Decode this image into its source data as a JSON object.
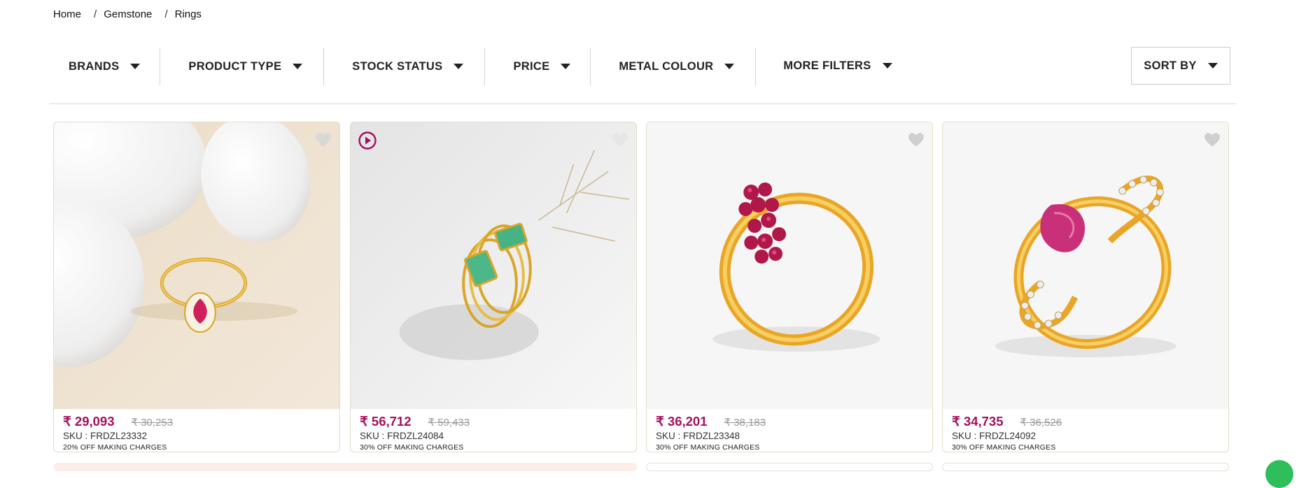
{
  "breadcrumb": {
    "home": "Home",
    "sep": "/",
    "category": "Gemstone",
    "current": "Rings"
  },
  "filters": [
    {
      "label": "BRANDS",
      "icon": "chevron-down-icon"
    },
    {
      "label": "PRODUCT TYPE",
      "icon": "chevron-down-icon"
    },
    {
      "label": "STOCK STATUS",
      "icon": "chevron-down-icon"
    },
    {
      "label": "PRICE",
      "icon": "chevron-down-icon"
    },
    {
      "label": "METAL COLOUR",
      "icon": "chevron-down-icon"
    },
    {
      "label": "MORE FILTERS",
      "icon": "chevron-down-icon"
    }
  ],
  "sort": {
    "label": "SORT BY",
    "icon": "chevron-down-icon"
  },
  "products": [
    {
      "price": "₹ 29,093",
      "mrp": "₹ 30,253",
      "sku": "SKU : FRDZL23332",
      "offer": "20% OFF MAKING CHARGES",
      "has_video": false
    },
    {
      "price": "₹ 56,712",
      "mrp": "₹ 59,433",
      "sku": "SKU : FRDZL24084",
      "offer": "30% OFF MAKING CHARGES",
      "has_video": true
    },
    {
      "price": "₹ 36,201",
      "mrp": "₹ 38,183",
      "sku": "SKU : FRDZL23348",
      "offer": "30% OFF MAKING CHARGES",
      "has_video": false
    },
    {
      "price": "₹ 34,735",
      "mrp": "₹ 36,526",
      "sku": "SKU : FRDZL24092",
      "offer": "30% OFF MAKING CHARGES",
      "has_video": false
    }
  ],
  "colors": {
    "price": "#a50f5f",
    "card_border": "#e3dcc8",
    "chat": "#2fbe5c"
  }
}
